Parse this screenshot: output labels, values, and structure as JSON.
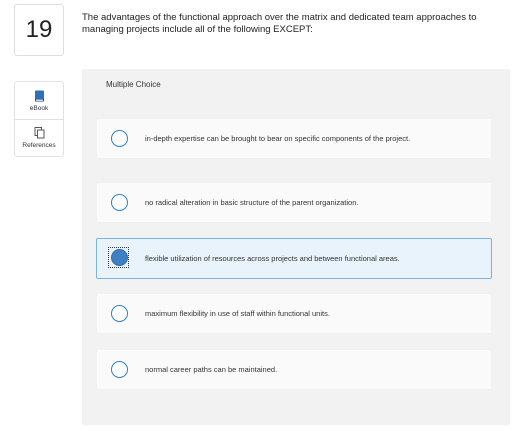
{
  "question": {
    "number": "19",
    "text": "The advantages of the functional approach over the matrix and dedicated team approaches to managing projects include all of the following EXCEPT:"
  },
  "tools": [
    {
      "label": "eBook",
      "icon": "ebook-icon"
    },
    {
      "label": "References",
      "icon": "references-icon"
    }
  ],
  "panel": {
    "title": "Multiple Choice",
    "choices": [
      {
        "text": "in-depth expertise can be brought to bear on specific components of the project.",
        "selected": false
      },
      {
        "text": "no radical alteration in basic structure of the parent organization.",
        "selected": false
      },
      {
        "text": "flexible utilization of resources across projects and between functional areas.",
        "selected": true
      },
      {
        "text": "maximum flexibility in use of staff within functional units.",
        "selected": false
      },
      {
        "text": "normal career paths can be maintained.",
        "selected": false
      }
    ]
  },
  "colors": {
    "accent": "#2d7fc4",
    "selected_bg": "#e8f3fc",
    "selected_border": "#7ab4e0",
    "panel_bg": "#f2f2f2"
  }
}
